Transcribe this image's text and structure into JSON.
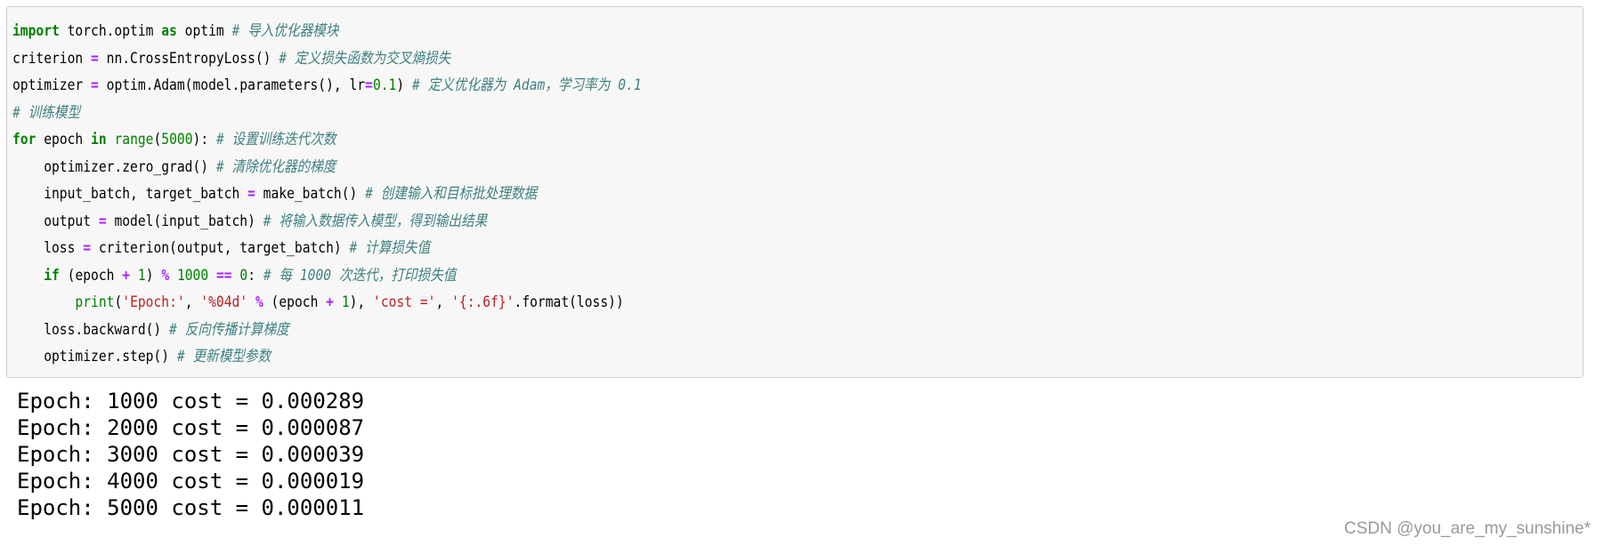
{
  "code": {
    "lines": [
      [
        [
          "kw",
          "import"
        ],
        [
          "t",
          " torch.optim "
        ],
        [
          "kw",
          "as"
        ],
        [
          "t",
          " optim "
        ],
        [
          "cm",
          "# 导入优化器模块"
        ]
      ],
      [
        [
          "t",
          "criterion "
        ],
        [
          "op",
          "="
        ],
        [
          "t",
          " nn.CrossEntropyLoss() "
        ],
        [
          "cm",
          "# 定义损失函数为交叉熵损失"
        ]
      ],
      [
        [
          "t",
          "optimizer "
        ],
        [
          "op",
          "="
        ],
        [
          "t",
          " optim.Adam(model.parameters(), lr"
        ],
        [
          "op",
          "="
        ],
        [
          "num",
          "0.1"
        ],
        [
          "t",
          ") "
        ],
        [
          "cm",
          "# 定义优化器为 Adam，学习率为 0.1"
        ]
      ],
      [
        [
          "cm",
          "# 训练模型"
        ]
      ],
      [
        [
          "kw",
          "for"
        ],
        [
          "t",
          " epoch "
        ],
        [
          "kw",
          "in"
        ],
        [
          "t",
          " "
        ],
        [
          "bi",
          "range"
        ],
        [
          "t",
          "("
        ],
        [
          "num",
          "5000"
        ],
        [
          "t",
          "): "
        ],
        [
          "cm",
          "# 设置训练迭代次数"
        ]
      ],
      [
        [
          "t",
          "    optimizer.zero_grad() "
        ],
        [
          "cm",
          "# 清除优化器的梯度"
        ]
      ],
      [
        [
          "t",
          "    input_batch, target_batch "
        ],
        [
          "op",
          "="
        ],
        [
          "t",
          " make_batch() "
        ],
        [
          "cm",
          "# 创建输入和目标批处理数据"
        ]
      ],
      [
        [
          "t",
          "    output "
        ],
        [
          "op",
          "="
        ],
        [
          "t",
          " model(input_batch) "
        ],
        [
          "cm",
          "# 将输入数据传入模型，得到输出结果"
        ]
      ],
      [
        [
          "t",
          "    loss "
        ],
        [
          "op",
          "="
        ],
        [
          "t",
          " criterion(output, target_batch) "
        ],
        [
          "cm",
          "# 计算损失值"
        ]
      ],
      [
        [
          "t",
          "    "
        ],
        [
          "kw",
          "if"
        ],
        [
          "t",
          " (epoch "
        ],
        [
          "op",
          "+"
        ],
        [
          "t",
          " "
        ],
        [
          "num",
          "1"
        ],
        [
          "t",
          ") "
        ],
        [
          "op",
          "%"
        ],
        [
          "t",
          " "
        ],
        [
          "num",
          "1000"
        ],
        [
          "t",
          " "
        ],
        [
          "op",
          "=="
        ],
        [
          "t",
          " "
        ],
        [
          "num",
          "0"
        ],
        [
          "t",
          ": "
        ],
        [
          "cm",
          "# 每 1000 次迭代，打印损失值"
        ]
      ],
      [
        [
          "t",
          "        "
        ],
        [
          "bi",
          "print"
        ],
        [
          "t",
          "("
        ],
        [
          "str",
          "'Epoch:'"
        ],
        [
          "t",
          ", "
        ],
        [
          "str",
          "'%04d'"
        ],
        [
          "t",
          " "
        ],
        [
          "op",
          "%"
        ],
        [
          "t",
          " (epoch "
        ],
        [
          "op",
          "+"
        ],
        [
          "t",
          " "
        ],
        [
          "num",
          "1"
        ],
        [
          "t",
          "), "
        ],
        [
          "str",
          "'cost ='"
        ],
        [
          "t",
          ", "
        ],
        [
          "str",
          "'{:.6f}'"
        ],
        [
          "t",
          ".format(loss))"
        ]
      ],
      [
        [
          "t",
          "    loss.backward() "
        ],
        [
          "cm",
          "# 反向传播计算梯度"
        ]
      ],
      [
        [
          "t",
          "    optimizer.step() "
        ],
        [
          "cm",
          "# 更新模型参数"
        ]
      ]
    ]
  },
  "output": {
    "lines": [
      "Epoch: 1000 cost = 0.000289",
      "Epoch: 2000 cost = 0.000087",
      "Epoch: 3000 cost = 0.000039",
      "Epoch: 4000 cost = 0.000019",
      "Epoch: 5000 cost = 0.000011"
    ]
  },
  "watermark": "CSDN @you_are_my_sunshine*",
  "colors": {
    "keyword": "#008000",
    "operator": "#aa22ff",
    "string": "#ba2121",
    "comment": "#408080",
    "cell_background": "#f7f7f7"
  }
}
